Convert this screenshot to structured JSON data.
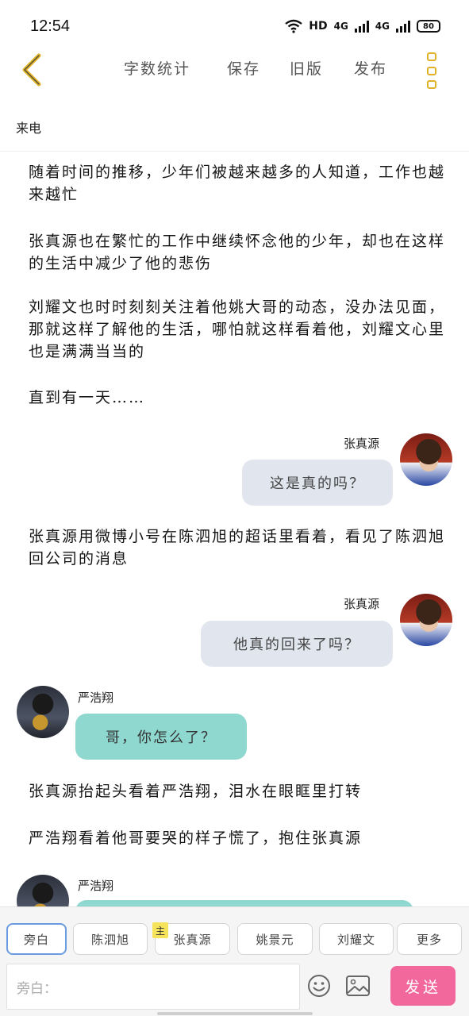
{
  "status_bar": {
    "time": "12:54",
    "network_hd": "HD",
    "signal1": "4G",
    "signal2": "4G",
    "battery": "80"
  },
  "toolbar": {
    "word_count": "字数统计",
    "save": "保存",
    "old_version": "旧版",
    "publish": "发布"
  },
  "chapter_title": "来电",
  "content": {
    "p1": "随着时间的推移，少年们被越来越多的人知道，工作也越来越忙",
    "p2": "张真源也在繁忙的工作中继续怀念他的少年，却也在这样的生活中减少了他的悲伤",
    "p3": "刘耀文也时时刻刻关注着他姚大哥的动态，没办法见面，那就这样了解他的生活，哪怕就这样看着他，刘耀文心里也是满满当当的",
    "p4": "直到有一天……",
    "msg1_speaker": "张真源",
    "msg1_text": "这是真的吗？",
    "p5": "张真源用微博小号在陈泗旭的超话里看着，看见了陈泗旭回公司的消息",
    "msg2_speaker": "张真源",
    "msg2_text": "他真的回来了吗？",
    "msg3_speaker": "严浩翔",
    "msg3_text": "哥，你怎么了？",
    "p6": "张真源抬起头看着严浩翔，泪水在眼眶里打转",
    "p7": "严浩翔看着他哥要哭的样子慌了，抱住张真源",
    "msg4_speaker": "严浩翔"
  },
  "roles": {
    "narration": "旁白",
    "role1": "陈泗旭",
    "main_badge": "主",
    "role2": "张真源",
    "role3": "姚景元",
    "role4": "刘耀文",
    "more": "更多"
  },
  "input": {
    "placeholder": "旁白："
  },
  "send_label": "发送",
  "colors": {
    "accent_yellow": "#e0b22a",
    "send_pink": "#f2689c",
    "bubble_gray": "#e1e6ee",
    "bubble_teal": "#8ed8cf"
  },
  "icons": [
    "back-chevron-icon",
    "menu-dots-icon",
    "emoji-icon",
    "image-icon",
    "wifi-icon",
    "signal-icon",
    "battery-icon"
  ]
}
